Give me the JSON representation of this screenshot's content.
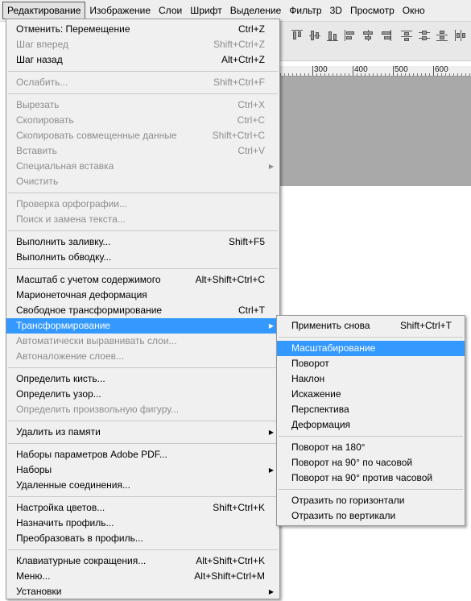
{
  "menubar": [
    {
      "label": "Редактирование",
      "open": true
    },
    {
      "label": "Изображение"
    },
    {
      "label": "Слои"
    },
    {
      "label": "Шрифт"
    },
    {
      "label": "Выделение"
    },
    {
      "label": "Фильтр"
    },
    {
      "label": "3D"
    },
    {
      "label": "Просмотр"
    },
    {
      "label": "Окно"
    }
  ],
  "ruler": {
    "labels": [
      "300",
      "400",
      "500",
      "600"
    ]
  },
  "colors": {
    "highlight": "#3399ff",
    "disabled_text": "#8d8d8d",
    "menu_bg": "#f0f0f0",
    "canvas": "#a9a9a9"
  },
  "edit_menu": {
    "groups": [
      [
        {
          "label": "Отменить: Перемещение",
          "shortcut": "Ctrl+Z"
        },
        {
          "label": "Шаг вперед",
          "shortcut": "Shift+Ctrl+Z",
          "disabled": true
        },
        {
          "label": "Шаг назад",
          "shortcut": "Alt+Ctrl+Z"
        }
      ],
      [
        {
          "label": "Ослабить...",
          "shortcut": "Shift+Ctrl+F",
          "disabled": true
        }
      ],
      [
        {
          "label": "Вырезать",
          "shortcut": "Ctrl+X",
          "disabled": true
        },
        {
          "label": "Скопировать",
          "shortcut": "Ctrl+C",
          "disabled": true
        },
        {
          "label": "Скопировать совмещенные данные",
          "shortcut": "Shift+Ctrl+C",
          "disabled": true
        },
        {
          "label": "Вставить",
          "shortcut": "Ctrl+V",
          "disabled": true
        },
        {
          "label": "Специальная вставка",
          "submenu": true,
          "disabled": true
        },
        {
          "label": "Очистить",
          "disabled": true
        }
      ],
      [
        {
          "label": "Проверка орфографии...",
          "disabled": true
        },
        {
          "label": "Поиск и замена текста...",
          "disabled": true
        }
      ],
      [
        {
          "label": "Выполнить заливку...",
          "shortcut": "Shift+F5"
        },
        {
          "label": "Выполнить обводку..."
        }
      ],
      [
        {
          "label": "Масштаб с учетом содержимого",
          "shortcut": "Alt+Shift+Ctrl+C"
        },
        {
          "label": "Марионеточная деформация"
        },
        {
          "label": "Свободное трансформирование",
          "shortcut": "Ctrl+T"
        },
        {
          "label": "Трансформирование",
          "submenu": true,
          "highlighted": true
        },
        {
          "label": "Автоматически выравнивать слои...",
          "disabled": true
        },
        {
          "label": "Автоналожение слоев...",
          "disabled": true
        }
      ],
      [
        {
          "label": "Определить кисть..."
        },
        {
          "label": "Определить узор..."
        },
        {
          "label": "Определить произвольную фигуру...",
          "disabled": true
        }
      ],
      [
        {
          "label": "Удалить из памяти",
          "submenu": true
        }
      ],
      [
        {
          "label": "Наборы параметров Adobe PDF..."
        },
        {
          "label": "Наборы",
          "submenu": true
        },
        {
          "label": "Удаленные соединения..."
        }
      ],
      [
        {
          "label": "Настройка цветов...",
          "shortcut": "Shift+Ctrl+K"
        },
        {
          "label": "Назначить профиль..."
        },
        {
          "label": "Преобразовать в профиль..."
        }
      ],
      [
        {
          "label": "Клавиатурные сокращения...",
          "shortcut": "Alt+Shift+Ctrl+K"
        },
        {
          "label": "Меню...",
          "shortcut": "Alt+Shift+Ctrl+M"
        },
        {
          "label": "Установки",
          "submenu": true
        }
      ]
    ]
  },
  "transform_submenu": {
    "groups": [
      [
        {
          "label": "Применить снова",
          "shortcut": "Shift+Ctrl+T"
        }
      ],
      [
        {
          "label": "Масштабирование",
          "highlighted": true
        },
        {
          "label": "Поворот"
        },
        {
          "label": "Наклон"
        },
        {
          "label": "Искажение"
        },
        {
          "label": "Перспектива"
        },
        {
          "label": "Деформация"
        }
      ],
      [
        {
          "label": "Поворот на 180°"
        },
        {
          "label": "Поворот на 90° по часовой"
        },
        {
          "label": "Поворот на 90° против часовой"
        }
      ],
      [
        {
          "label": "Отразить по горизонтали"
        },
        {
          "label": "Отразить по вертикали"
        }
      ]
    ]
  }
}
